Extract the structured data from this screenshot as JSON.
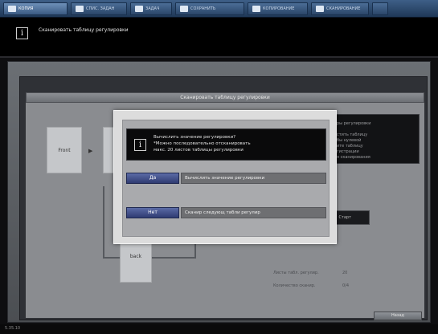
{
  "tabs": [
    {
      "label": "КОПИЯ",
      "active": true
    },
    {
      "label": "СПИС. ЗАДАН",
      "active": false
    },
    {
      "label": "ЗАДАЧ",
      "active": false
    },
    {
      "label": "СОХРАНИТЬ",
      "active": false
    },
    {
      "label": "КОПИРОВАНИЕ",
      "active": false
    },
    {
      "label": "СКАНИРОВАНИЕ",
      "active": false
    },
    {
      "label": "",
      "active": false
    }
  ],
  "message": "Сканировать таблицу регулировки",
  "window_title": "Сканировать таблицу регулировки",
  "diagram": {
    "front_label": "Front",
    "back_label": "back"
  },
  "right_panel": {
    "lines": [
      "ры регулировки",
      "стить таблицу",
      "бы нулевой",
      "ите таблицу",
      "гистрации",
      "я сканирования"
    ]
  },
  "start_label": "Старт",
  "stats": [
    {
      "label": "Листы табл. регулир.",
      "value": "20"
    },
    {
      "label": "Количество сканир.",
      "value": "0/4"
    }
  ],
  "ok_label": "Назад",
  "footer_text": "5.35.10",
  "modal": {
    "header_lines": [
      "Вычислить значение регулировки?",
      "*Можно последовательно отсканировать",
      "макс. 20 листов таблицы регулировки"
    ],
    "yes": {
      "button": "Да",
      "desc": "Вычислить значение регулировки"
    },
    "no": {
      "button": "Нет",
      "desc": "Сканир следующ табли регулир"
    }
  },
  "colors": {
    "accent": "#3b5b83",
    "button": "#2f3b72"
  },
  "icons": [
    "info-icon",
    "copy-icon",
    "list-icon",
    "job-icon",
    "save-icon",
    "scan-icon"
  ]
}
